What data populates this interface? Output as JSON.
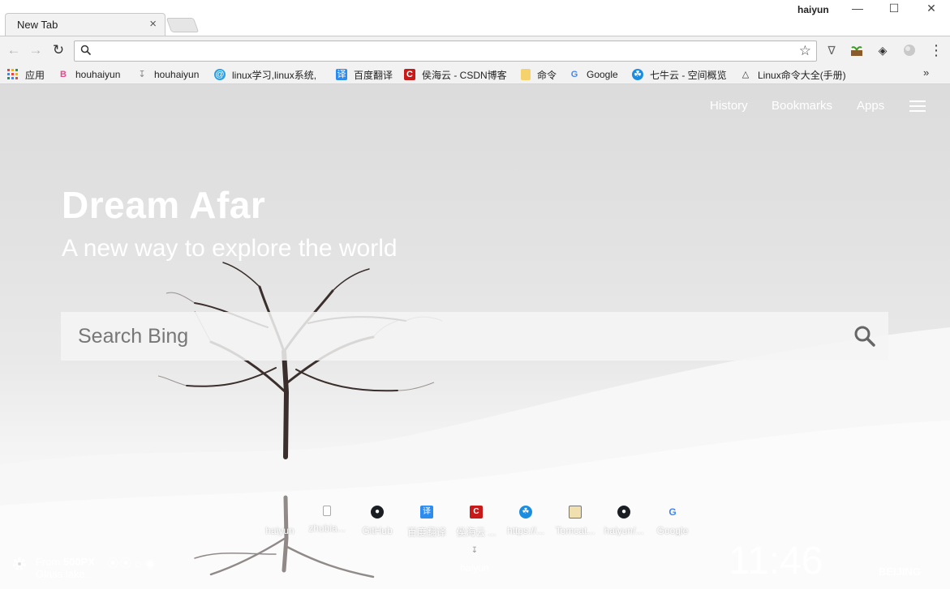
{
  "browser": {
    "tab_title": "New Tab",
    "tab_close": "×",
    "profile_name": "haiyun",
    "window_controls": {
      "minimize": "—",
      "maximize": "☐",
      "close": "✕"
    },
    "omnibox_value": "",
    "star": "☆",
    "menu": "⋮",
    "more_bookmarks": "»"
  },
  "bookmarks": [
    {
      "icon": "apps-grid-icon",
      "label": "应用"
    },
    {
      "icon": "pink-b-icon",
      "label": "houhaiyun"
    },
    {
      "icon": "download-icon",
      "label": "houhaiyun"
    },
    {
      "icon": "blue-circle-icon",
      "label": "linux学习,linux系统,"
    },
    {
      "icon": "translate-icon",
      "label": "百度翻译"
    },
    {
      "icon": "csdn-icon",
      "label": "侯海云 - CSDN博客"
    },
    {
      "icon": "folder-icon",
      "label": "命令"
    },
    {
      "icon": "google-icon",
      "label": "Google"
    },
    {
      "icon": "qiniu-icon",
      "label": "七牛云 - 空间概览"
    },
    {
      "icon": "linux-cmd-icon",
      "label": "Linux命令大全(手册)"
    }
  ],
  "page": {
    "nav": {
      "history": "History",
      "bookmarks": "Bookmarks",
      "apps": "Apps"
    },
    "hero_title": "Dream Afar",
    "hero_subtitle": "A new way to explore the world",
    "search_placeholder": "Search Bing",
    "shortcuts": [
      {
        "icon": "page-icon",
        "label": "haiyun"
      },
      {
        "icon": "page-icon",
        "label": "zhubia..."
      },
      {
        "icon": "github-icon",
        "label": "GitHub"
      },
      {
        "icon": "translate-icon",
        "label": "百度翻译"
      },
      {
        "icon": "csdn-icon",
        "label": "侯海云 ..."
      },
      {
        "icon": "qiniu-icon",
        "label": "https://..."
      },
      {
        "icon": "tomcat-icon",
        "label": "Tomcat..."
      },
      {
        "icon": "github-icon",
        "label": "haiyun/..."
      },
      {
        "icon": "google-icon",
        "label": "Google"
      }
    ],
    "shortcut_row2": {
      "icon": "download-icon",
      "label": "haiyun"
    },
    "credit": {
      "from_prefix": "From ",
      "source": "500PX",
      "photo_title": "Glass lake..."
    },
    "clock": "11:46",
    "city": "BEIJING"
  },
  "colors": {
    "chrome_bg": "#f2f2f2",
    "overlay_text": "#ffffff",
    "search_bg": "#f5f5f5"
  }
}
